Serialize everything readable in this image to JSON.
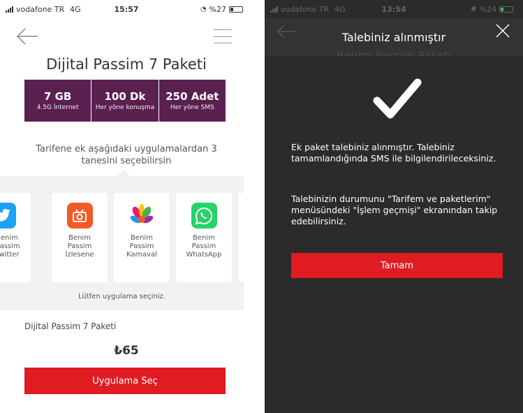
{
  "left": {
    "status": {
      "carrier": "vodafone TR",
      "network": "4G",
      "time": "15:57",
      "battery": "%27",
      "battery_level": 0.27
    },
    "title": "Dijital Passim 7 Paketi",
    "package": [
      {
        "value": "7 GB",
        "desc": "4.5G İnternet"
      },
      {
        "value": "100 Dk",
        "desc": "Her yöne konuşma"
      },
      {
        "value": "250 Adet",
        "desc": "Her yöne SMS"
      }
    ],
    "choose_text": "Tarifene ek aşağıdaki uygulamalardan 3 tanesini seçebilirsin",
    "apps": [
      {
        "name": "Benim Passim Twitter",
        "icon": "twitter-icon",
        "color": "#1da1f2"
      },
      {
        "name": "Benim Passim İzlesene",
        "icon": "izlesene-icon",
        "color": "#f15a24"
      },
      {
        "name": "Benim Passim Karnaval",
        "icon": "karnaval-icon",
        "color": "#ffffff"
      },
      {
        "name": "Benim Passim WhatsApp",
        "icon": "whatsapp-icon",
        "color": "#25d366"
      }
    ],
    "hint": "Lütfen uygulama seçiniz.",
    "price_name": "Dijital Passim 7 Paketi",
    "price": "₺65",
    "button": "Uygulama Seç",
    "accent_color": "#e11b22",
    "package_color": "#5a2050"
  },
  "right": {
    "status": {
      "carrier": "vodafone TR",
      "network": "4G",
      "time": "13:54",
      "battery": "%24",
      "battery_level": 0.24
    },
    "title": "Talebiniz alınmıştır",
    "behind_title": "Benim Passim Paketi",
    "message_1": "Ek paket talebiniz alınmıştır. Talebiniz tamamlandığında SMS ile bilgilendirileceksiniz.",
    "message_2": "Talebinizin durumunu \"Tarifem ve paketlerim\" menüsündeki \"İşlem geçmişi\" ekranından takip edebilirsiniz.",
    "button": "Tamam",
    "check_icon": "checkmark-icon"
  }
}
